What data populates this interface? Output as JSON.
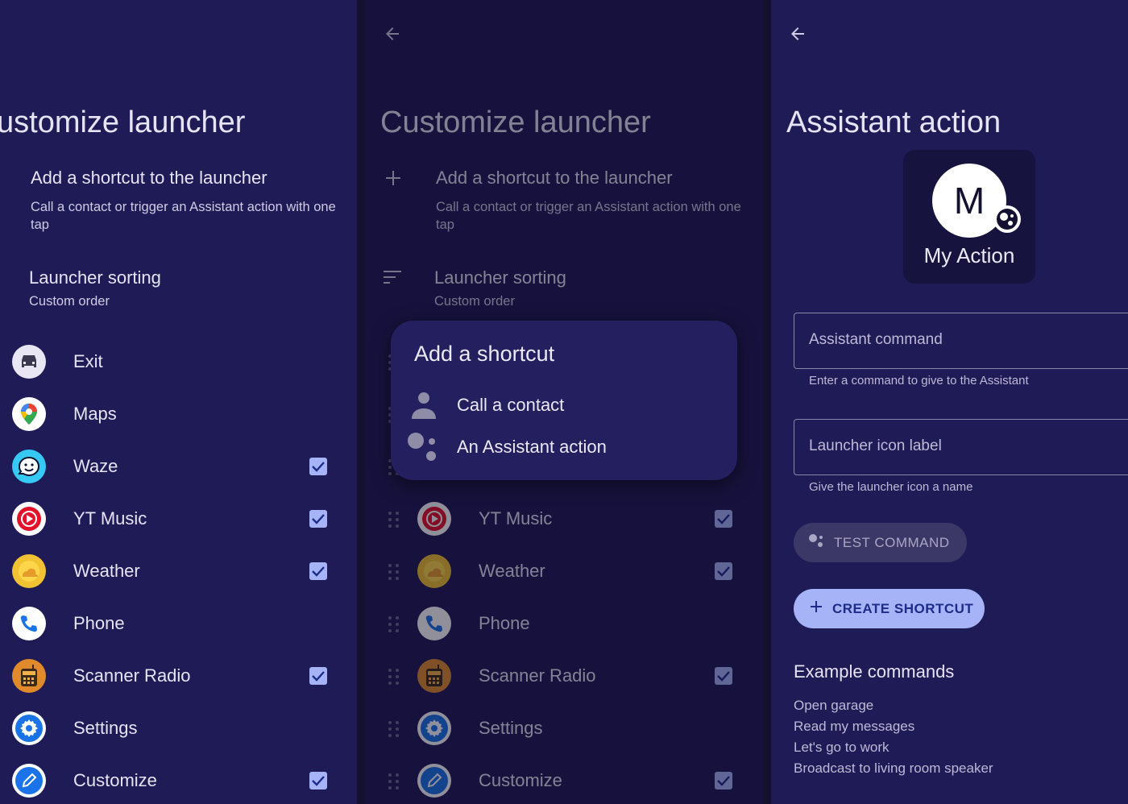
{
  "panel1": {
    "title": "ustomize launcher",
    "add_shortcut": {
      "title": "Add a shortcut to the launcher",
      "subtitle": "Call a contact or trigger an Assistant action with one tap"
    },
    "sorting": {
      "title": "Launcher sorting",
      "value": "Custom order"
    },
    "apps": [
      {
        "label": "Exit",
        "icon": "car-icon",
        "checked": false
      },
      {
        "label": "Maps",
        "icon": "maps-pin-icon",
        "checked": false
      },
      {
        "label": "Waze",
        "icon": "waze-icon",
        "checked": true
      },
      {
        "label": "YT Music",
        "icon": "yt-music-icon",
        "checked": true
      },
      {
        "label": "Weather",
        "icon": "weather-sun-icon",
        "checked": true
      },
      {
        "label": "Phone",
        "icon": "phone-icon",
        "checked": false
      },
      {
        "label": "Scanner Radio",
        "icon": "scanner-radio-icon",
        "checked": true
      },
      {
        "label": "Settings",
        "icon": "gear-icon",
        "checked": false
      },
      {
        "label": "Customize",
        "icon": "pencil-icon",
        "checked": true
      }
    ]
  },
  "panel2": {
    "title": "Customize launcher",
    "add_shortcut": {
      "title": "Add a shortcut to the launcher",
      "subtitle": "Call a contact or trigger an Assistant action with one tap"
    },
    "sorting": {
      "title": "Launcher sorting",
      "value": "Custom order"
    },
    "dialog": {
      "title": "Add a shortcut",
      "options": [
        {
          "label": "Call a contact",
          "icon": "person-icon"
        },
        {
          "label": "An Assistant action",
          "icon": "assistant-icon"
        }
      ]
    },
    "apps": [
      {
        "label": "YT Music",
        "icon": "yt-music-icon",
        "checked": true
      },
      {
        "label": "Weather",
        "icon": "weather-sun-icon",
        "checked": true
      },
      {
        "label": "Phone",
        "icon": "phone-icon",
        "checked": false
      },
      {
        "label": "Scanner Radio",
        "icon": "scanner-radio-icon",
        "checked": true
      },
      {
        "label": "Settings",
        "icon": "gear-icon",
        "checked": false
      },
      {
        "label": "Customize",
        "icon": "pencil-icon",
        "checked": true
      }
    ]
  },
  "panel3": {
    "title": "Assistant action",
    "preview": {
      "letter": "M",
      "label": "My Action"
    },
    "fields": [
      {
        "label": "Assistant command",
        "helper": "Enter a command to give to the Assistant"
      },
      {
        "label": "Launcher icon label",
        "helper": "Give the launcher icon a name"
      }
    ],
    "test_button": "TEST COMMAND",
    "create_button": "CREATE SHORTCUT",
    "examples_title": "Example commands",
    "examples": [
      "Open garage",
      "Read my messages",
      "Let's go to work",
      "Broadcast to living room speaker"
    ]
  },
  "colors": {
    "background": "#1f1b57",
    "accent": "#a6b4f7",
    "text": "#e6e3f4"
  }
}
